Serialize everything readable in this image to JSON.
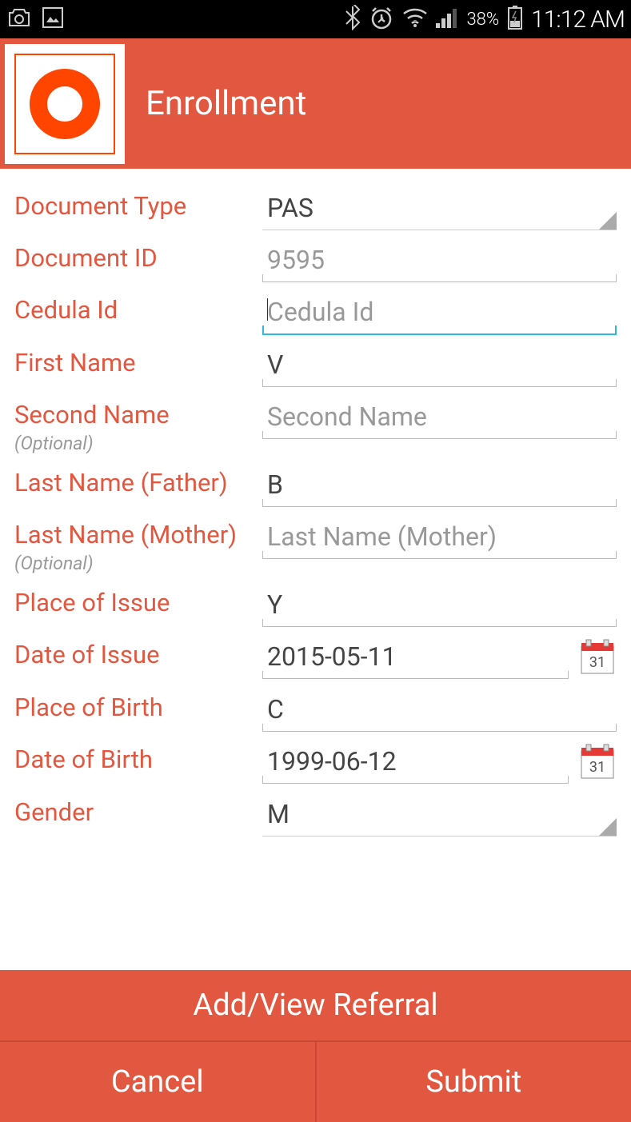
{
  "statusbar": {
    "battery": "38%",
    "time": "11:12 AM"
  },
  "header": {
    "title": "Enrollment"
  },
  "form": {
    "doc_type": {
      "label": "Document Type",
      "value": "PAS"
    },
    "doc_id": {
      "label": "Document ID",
      "value": "9595"
    },
    "cedula": {
      "label": "Cedula Id",
      "placeholder": "Cedula Id",
      "value": ""
    },
    "first_name": {
      "label": "First Name",
      "value": "V"
    },
    "second_name": {
      "label": "Second Name",
      "optional": "(Optional)",
      "placeholder": "Second Name",
      "value": ""
    },
    "last_name_father": {
      "label": "Last Name (Father)",
      "value": "B"
    },
    "last_name_mother": {
      "label": "Last Name (Mother)",
      "optional": "(Optional)",
      "placeholder": "Last Name (Mother)",
      "value": ""
    },
    "place_issue": {
      "label": "Place of Issue",
      "value": "Y"
    },
    "date_issue": {
      "label": "Date of Issue",
      "value": "2015-05-11"
    },
    "place_birth": {
      "label": "Place of Birth",
      "value": "C"
    },
    "date_birth": {
      "label": "Date of Birth",
      "value": "1999-06-12"
    },
    "gender": {
      "label": "Gender",
      "value": "M"
    }
  },
  "buttons": {
    "referral": "Add/View Referral",
    "cancel": "Cancel",
    "submit": "Submit"
  }
}
